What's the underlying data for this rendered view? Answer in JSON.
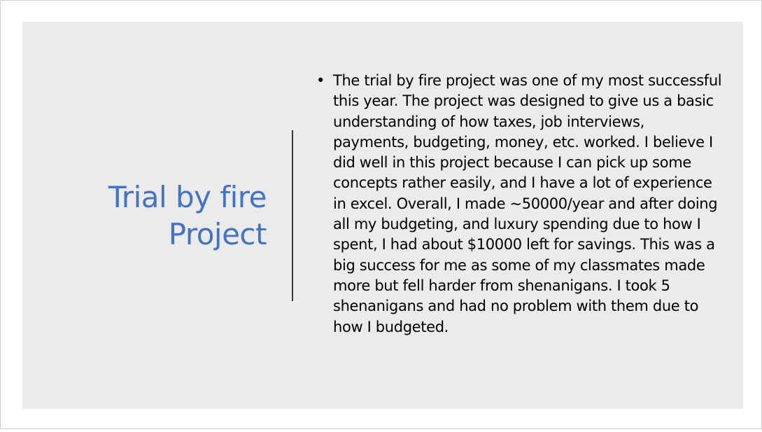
{
  "slide": {
    "title_line1": "Trial by fire",
    "title_line2": "Project",
    "bullet_symbol": "•",
    "bullet_text": "The trial by fire project was one of my most successful this year. The project was designed to give us a basic understanding of how taxes, job interviews, payments, budgeting, money, etc. worked. I believe I did well in this project because I can pick up some concepts rather easily, and I have a lot of experience in excel. Overall, I made ~50000/year and after doing all my budgeting, and luxury spending due to how I spent, I had about $10000 left for savings. This was a big success for me as some of my classmates made more but fell harder from shenanigans. I took 5 shenanigans and had no problem with them due to how I budgeted."
  },
  "colors": {
    "title": "#4472c4",
    "slide_background": "#ebebeb",
    "body_text": "#000000"
  }
}
